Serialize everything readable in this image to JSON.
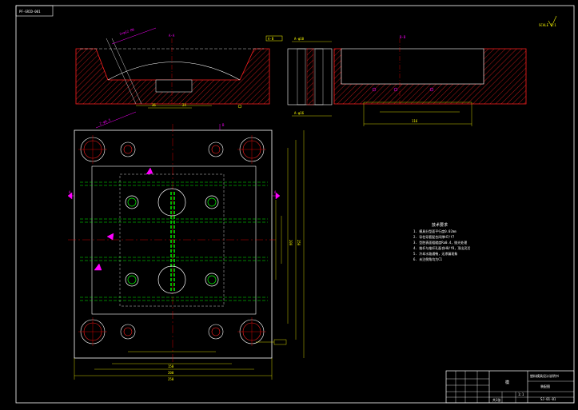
{
  "sheet": {
    "tag": "PF-GRID-001",
    "tag_top_right": "SCALE 1:1"
  },
  "section_labels": {
    "left": "A-A",
    "right": "B-B",
    "note_top": "2×φ12 M6",
    "detail": "A-B"
  },
  "tech_requirements": {
    "title": "技术要求",
    "items": [
      "1. 模具分型面平行度0.02mm",
      "2. 导柱导套配合间隙H7/f7",
      "3. 型腔表面粗糙度Ra0.4，抛光处理",
      "4. 推杆与推杆孔配合H8/f8，顶出灵活",
      "5. 冷却水路通畅，无渗漏现象",
      "6. 未注倒角均为C1"
    ]
  },
  "title_block": {
    "part_name": "模",
    "company": "塑料模具设计说明书",
    "drawing_title": "装配图",
    "drawing_no": "SJ-01-01",
    "scale": "1:1",
    "sheet": "共1张"
  },
  "colors": {
    "background": "#000000",
    "outline": "#ffffff",
    "hatch": "#ff2020",
    "dimension": "#ffff00",
    "centerline": "#ff0000",
    "cooling": "#00ff00",
    "text_magenta": "#ff00ff",
    "cyan": "#00ffff"
  },
  "icons": {
    "hole": "circle-cross-icon",
    "section_arrow": "triangle-arrow-icon"
  }
}
